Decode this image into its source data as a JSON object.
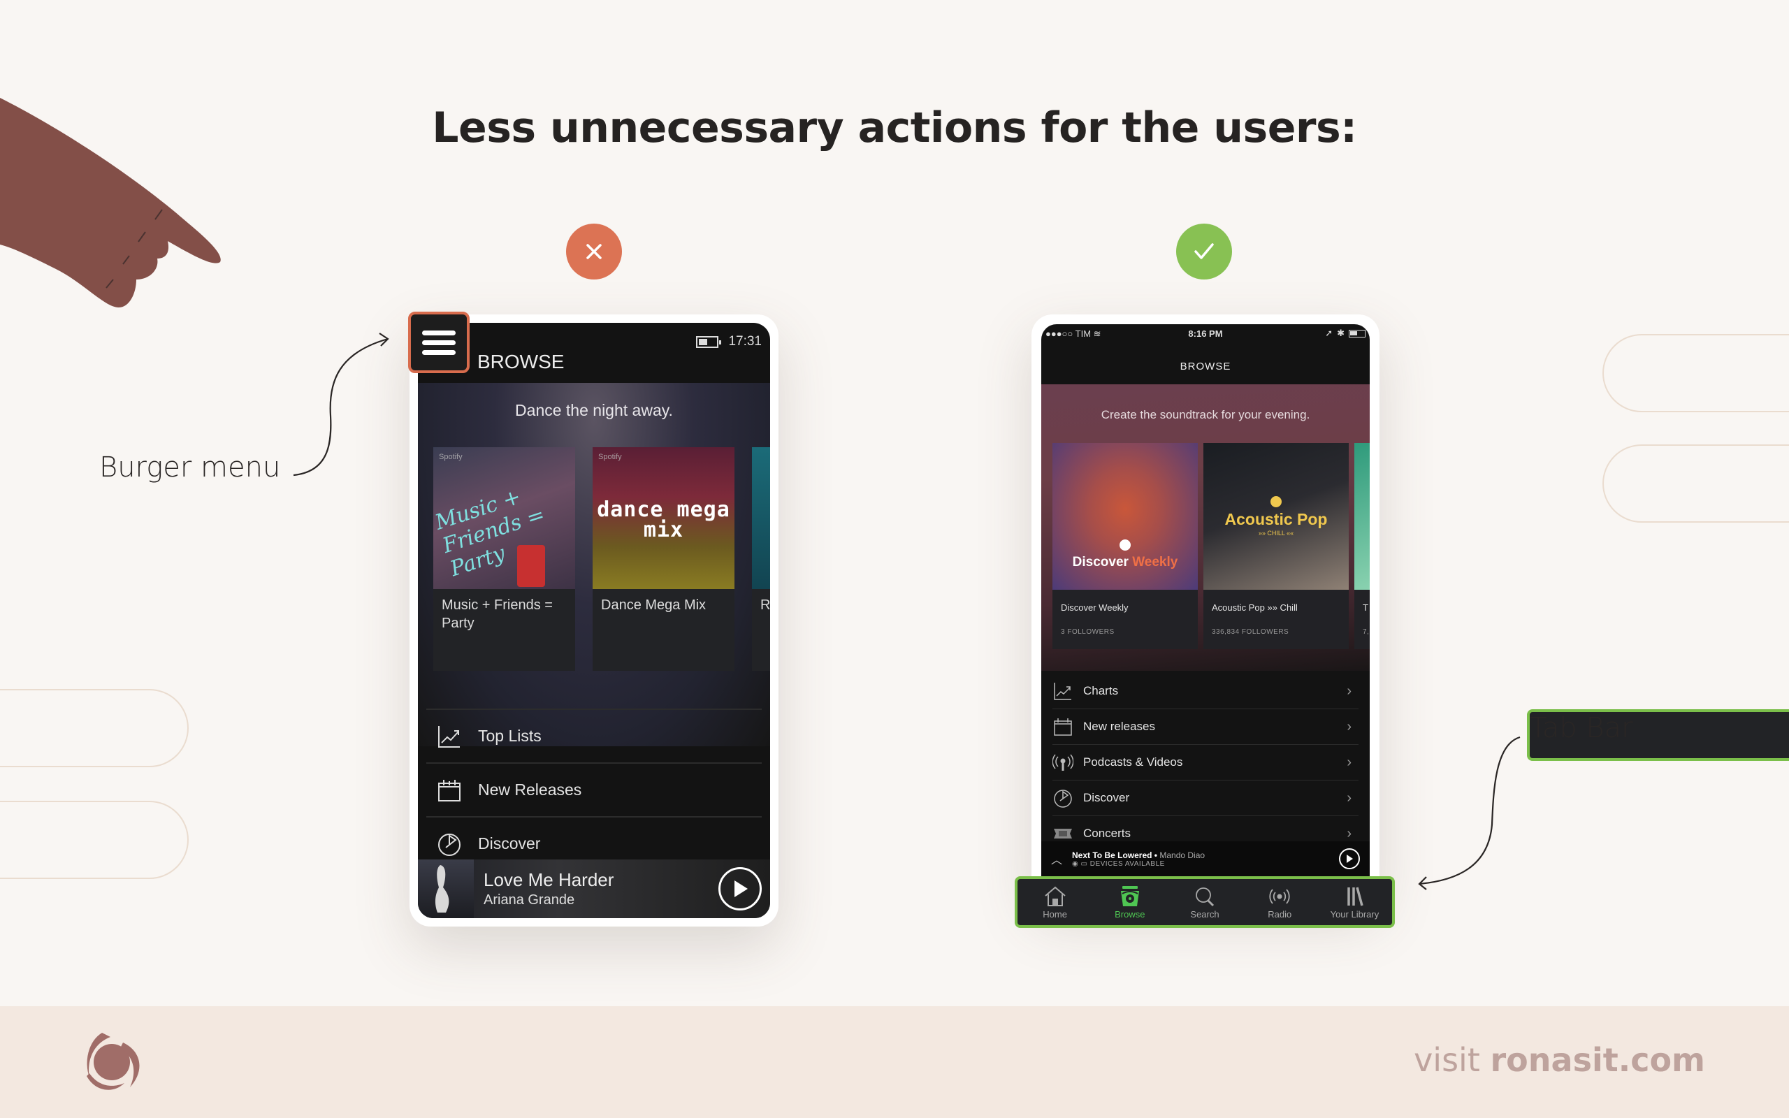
{
  "title": "Less unnecessary actions for the users:",
  "colors": {
    "bad": "#dc7354",
    "good": "#88c153",
    "highlight_bad": "#d86c4d",
    "highlight_good": "#7bbf4a",
    "hand": "#834f48",
    "accent_green": "#4fc653"
  },
  "badges": {
    "bad_icon": "close-icon",
    "good_icon": "check-icon"
  },
  "callouts": {
    "burger": "Burger menu",
    "tabbar": "Tab Bar"
  },
  "left_phone": {
    "status_time": "17:31",
    "header_title": "BROWSE",
    "hero_text": "Dance the night away.",
    "cards": [
      {
        "label": "Music + Friends = Party",
        "art_text": "Music + Friends = Party",
        "brand": "Spotify"
      },
      {
        "label": "Dance Mega Mix",
        "art_text": "dance mega mix",
        "brand": "Spotify"
      },
      {
        "label": "R",
        "art_text": "",
        "brand": ""
      }
    ],
    "menu": [
      {
        "label": "Top Lists",
        "icon": "chart-icon"
      },
      {
        "label": "New Releases",
        "icon": "calendar-icon"
      },
      {
        "label": "Discover",
        "icon": "discover-icon"
      }
    ],
    "player": {
      "song": "Love Me Harder",
      "artist": "Ariana Grande"
    }
  },
  "right_phone": {
    "status": {
      "carrier": "●●●○○ TIM",
      "time": "8:16 PM"
    },
    "header_title": "BROWSE",
    "hero_text": "Create the soundtrack for your evening.",
    "cards": [
      {
        "name": "Discover Weekly",
        "followers": "3 FOLLOWERS",
        "art_text_a": "Discover",
        "art_text_b": "Weekly"
      },
      {
        "name": "Acoustic Pop »» Chill",
        "followers": "336,834 FOLLOWERS",
        "art_text_a": "Acoustic Pop",
        "art_text_b": "»» CHILL ««"
      },
      {
        "name": "T",
        "followers": "7,",
        "art_text_a": "",
        "art_text_b": ""
      }
    ],
    "menu": [
      {
        "label": "Charts",
        "icon": "chart-icon"
      },
      {
        "label": "New releases",
        "icon": "calendar-icon"
      },
      {
        "label": "Podcasts & Videos",
        "icon": "podcast-icon"
      },
      {
        "label": "Discover",
        "icon": "discover-icon"
      },
      {
        "label": "Concerts",
        "icon": "ticket-icon"
      }
    ],
    "player": {
      "song": "Next To Be Lowered",
      "artist": "Mando Diao",
      "devices": "DEVICES AVAILABLE"
    },
    "tabs": [
      {
        "label": "Home",
        "icon": "home-icon",
        "active": false
      },
      {
        "label": "Browse",
        "icon": "browse-icon",
        "active": true
      },
      {
        "label": "Search",
        "icon": "search-icon",
        "active": false
      },
      {
        "label": "Radio",
        "icon": "radio-icon",
        "active": false
      },
      {
        "label": "Your Library",
        "icon": "library-icon",
        "active": false
      }
    ]
  },
  "footer": {
    "prefix": "visit",
    "site": "ronasit.com"
  }
}
